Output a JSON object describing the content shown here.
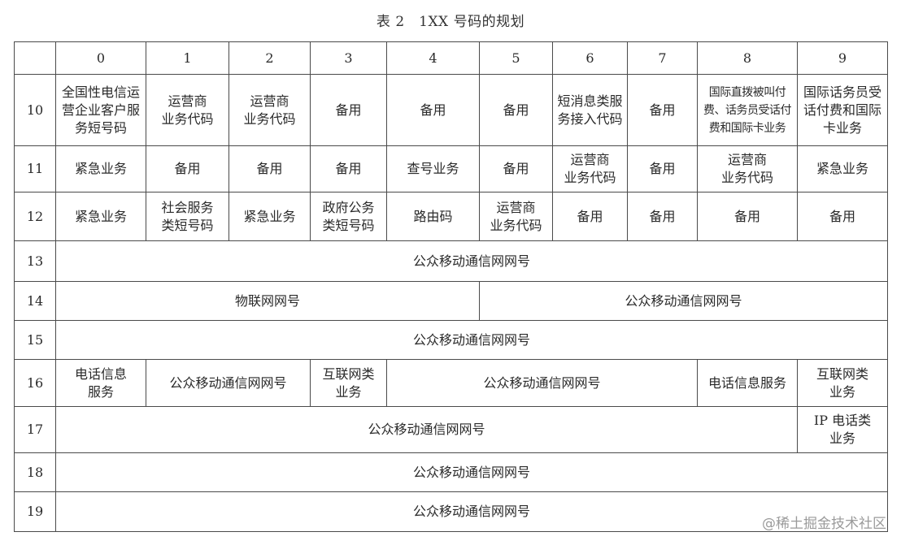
{
  "title": "表 2　1XX 号码的规划",
  "watermark": "@稀土掘金技术社区",
  "header_cols": [
    "0",
    "1",
    "2",
    "3",
    "4",
    "5",
    "6",
    "7",
    "8",
    "9"
  ],
  "rows": [
    {
      "prefix": "10",
      "cells": [
        {
          "text": "全国性电信运营企业客户服务短号码",
          "span": 1
        },
        {
          "text": "运营商\n业务代码",
          "span": 1
        },
        {
          "text": "运营商\n业务代码",
          "span": 1
        },
        {
          "text": "备用",
          "span": 1
        },
        {
          "text": "备用",
          "span": 1
        },
        {
          "text": "备用",
          "span": 1
        },
        {
          "text": "短消息类服务接入代码",
          "span": 1
        },
        {
          "text": "备用",
          "span": 1
        },
        {
          "text": "国际直拨被叫付费、话务员受话付费和国际卡业务",
          "span": 1,
          "small": true
        },
        {
          "text": "国际话务员受话付费和国际卡业务",
          "span": 1
        }
      ]
    },
    {
      "prefix": "11",
      "cells": [
        {
          "text": "紧急业务",
          "span": 1
        },
        {
          "text": "备用",
          "span": 1
        },
        {
          "text": "备用",
          "span": 1
        },
        {
          "text": "备用",
          "span": 1
        },
        {
          "text": "查号业务",
          "span": 1
        },
        {
          "text": "备用",
          "span": 1
        },
        {
          "text": "运营商\n业务代码",
          "span": 1
        },
        {
          "text": "备用",
          "span": 1
        },
        {
          "text": "运营商\n业务代码",
          "span": 1
        },
        {
          "text": "紧急业务",
          "span": 1
        }
      ]
    },
    {
      "prefix": "12",
      "cells": [
        {
          "text": "紧急业务",
          "span": 1
        },
        {
          "text": "社会服务\n类短号码",
          "span": 1
        },
        {
          "text": "紧急业务",
          "span": 1
        },
        {
          "text": "政府公务\n类短号码",
          "span": 1
        },
        {
          "text": "路由码",
          "span": 1
        },
        {
          "text": "运营商\n业务代码",
          "span": 1
        },
        {
          "text": "备用",
          "span": 1
        },
        {
          "text": "备用",
          "span": 1
        },
        {
          "text": "备用",
          "span": 1
        },
        {
          "text": "备用",
          "span": 1
        }
      ]
    },
    {
      "prefix": "13",
      "cells": [
        {
          "text": "公众移动通信网网号",
          "span": 10
        }
      ]
    },
    {
      "prefix": "14",
      "cells": [
        {
          "text": "物联网网号",
          "span": 5
        },
        {
          "text": "公众移动通信网网号",
          "span": 5
        }
      ]
    },
    {
      "prefix": "15",
      "cells": [
        {
          "text": "公众移动通信网网号",
          "span": 10
        }
      ]
    },
    {
      "prefix": "16",
      "cells": [
        {
          "text": "电话信息\n服务",
          "span": 1
        },
        {
          "text": "公众移动通信网网号",
          "span": 2
        },
        {
          "text": "互联网类\n业务",
          "span": 1
        },
        {
          "text": "公众移动通信网网号",
          "span": 4
        },
        {
          "text": "电话信息服务",
          "span": 1
        },
        {
          "text": "互联网类\n业务",
          "span": 1
        }
      ]
    },
    {
      "prefix": "17",
      "cells": [
        {
          "text": "公众移动通信网网号",
          "span": 9
        },
        {
          "text": "IP 电话类\n业务",
          "span": 1
        }
      ]
    },
    {
      "prefix": "18",
      "cells": [
        {
          "text": "公众移动通信网网号",
          "span": 10
        }
      ]
    },
    {
      "prefix": "19",
      "cells": [
        {
          "text": "公众移动通信网网号",
          "span": 10
        }
      ]
    }
  ]
}
